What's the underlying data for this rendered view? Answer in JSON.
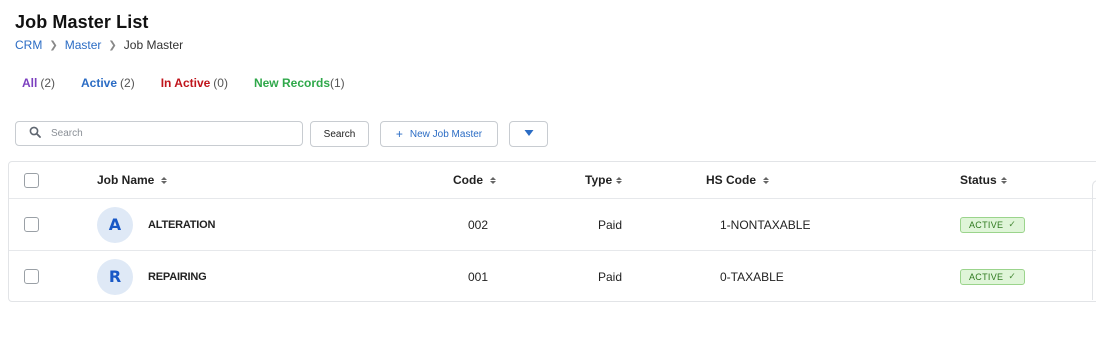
{
  "page": {
    "title": "Job Master List"
  },
  "breadcrumb": [
    {
      "label": "CRM"
    },
    {
      "label": "Master"
    },
    {
      "label": "Job Master"
    }
  ],
  "filters": [
    {
      "label": "All",
      "count": "(2)",
      "color": "#7b3fbf"
    },
    {
      "label": "Active",
      "count": "(2)",
      "color": "#2b6cc4"
    },
    {
      "label": "In Active",
      "count": "(0)",
      "color": "#c0141b"
    },
    {
      "label": "New Records",
      "count": "(1)",
      "color": "#2fa84a"
    }
  ],
  "toolbar": {
    "search_placeholder": "Search",
    "search_button": "Search",
    "new_button": "New Job Master",
    "accent_color": "#2b6cc4"
  },
  "table": {
    "columns": [
      "Job Name",
      "Code",
      "Type",
      "HS Code",
      "Status"
    ],
    "rows": [
      {
        "avatar": "A",
        "name": "ALTERATION",
        "code": "002",
        "type": "Paid",
        "hs_code": "1-NONTAXABLE",
        "status": "ACTIVE"
      },
      {
        "avatar": "R",
        "name": "REPAIRING",
        "code": "001",
        "type": "Paid",
        "hs_code": "0-TAXABLE",
        "status": "ACTIVE"
      }
    ]
  }
}
